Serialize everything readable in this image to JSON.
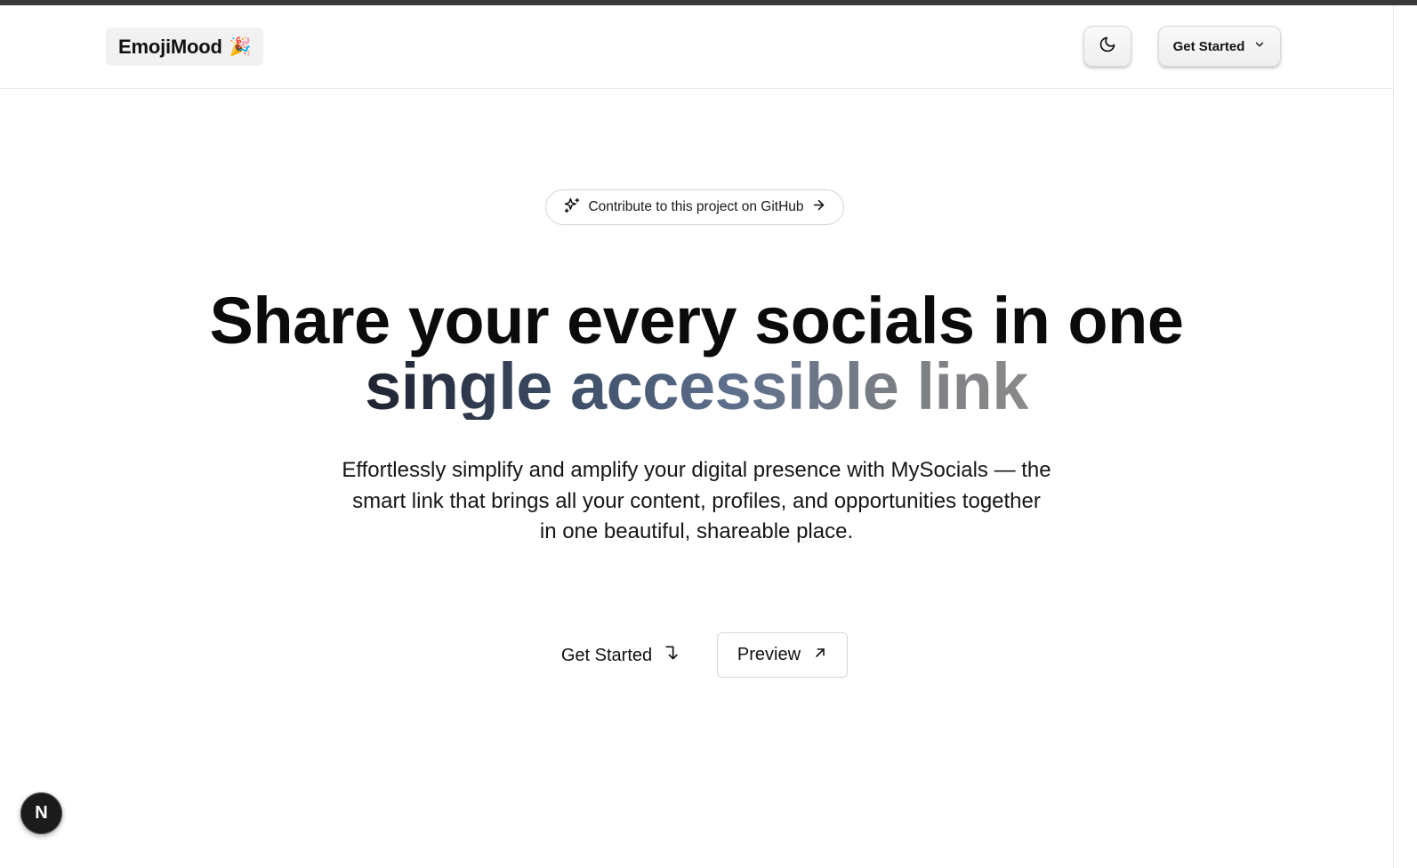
{
  "header": {
    "logo_text": "EmojiMood",
    "logo_emoji": "🎉",
    "theme_toggle_icon": "moon-icon",
    "get_started_label": "Get Started",
    "get_started_icon": "chevron-down-icon"
  },
  "github_pill": {
    "label": "Contribute to this project on GitHub",
    "leading_icon": "sparkles-icon",
    "trailing_icon": "arrow-right-icon"
  },
  "hero": {
    "line1": "Share your every socials in one",
    "line2": "single accessible link",
    "subtitle_lines": [
      "Effortlessly simplify and amplify your digital presence with MySocials — the",
      "smart link that brings all your content, profiles, and opportunities together",
      "in one beautiful, shareable place."
    ]
  },
  "cta": {
    "get_started_label": "Get Started",
    "get_started_icon": "arrow-down-right-turn-icon",
    "preview_label": "Preview",
    "preview_icon": "arrow-up-right-icon"
  },
  "badge": {
    "letter": "N",
    "icon": "nextjs-logo-icon"
  }
}
